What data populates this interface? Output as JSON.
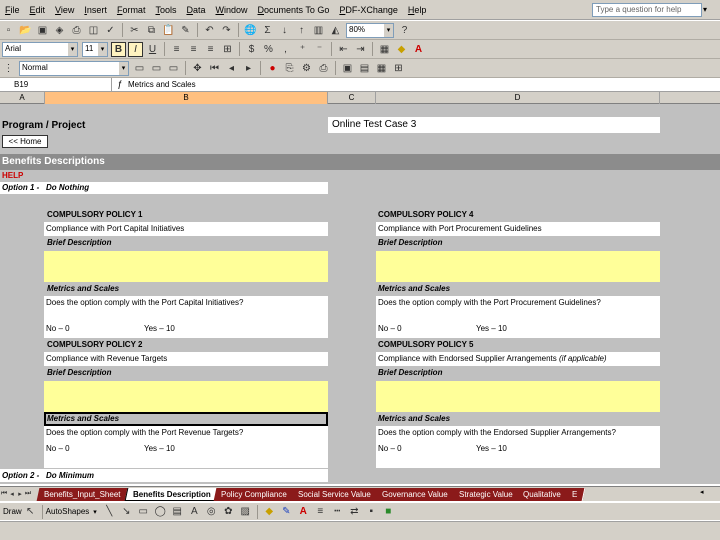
{
  "menu": {
    "items": [
      "File",
      "Edit",
      "View",
      "Insert",
      "Format",
      "Tools",
      "Data",
      "Window",
      "Documents To Go",
      "PDF-XChange",
      "Help"
    ],
    "help_placeholder": "Type a question for help"
  },
  "toolbar1": {
    "zoom": "80%"
  },
  "toolbar2": {
    "font": "Arial",
    "size": "11"
  },
  "toolbar3": {
    "style": "Normal"
  },
  "formula_bar": {
    "cell": "B19",
    "fx": "fx",
    "content": "Metrics and Scales"
  },
  "columns": [
    "A",
    "B",
    "C",
    "D"
  ],
  "sheet": {
    "program_label": "Program / Project",
    "program_value": "Online Test Case 3",
    "home_button": "<< Home",
    "section_header": "Benefits Descriptions",
    "help": "HELP",
    "option1_label": "Option 1 -",
    "option1_value": "Do Nothing",
    "policy1": {
      "title": "COMPULSORY POLICY 1",
      "name": "Compliance with Port Capital Initiatives",
      "brief": "Brief Description",
      "metrics": "Metrics and Scales",
      "question": "Does the option comply with the Port Capital Initiatives?",
      "no": "No – 0",
      "yes": "Yes – 10"
    },
    "policy4": {
      "title": "COMPULSORY POLICY 4",
      "name": "Compliance with Port Procurement Guidelines",
      "brief": "Brief Description",
      "metrics": "Metrics and Scales",
      "question": "Does the option comply with the Port Procurement Guidelines?",
      "no": "No – 0",
      "yes": "Yes – 10"
    },
    "policy2": {
      "title": "COMPULSORY POLICY 2",
      "name": "Compliance with Revenue Targets",
      "brief": "Brief Description",
      "metrics": "Metrics and Scales",
      "question": "Does the option comply with the Port Revenue Targets?",
      "no": "No – 0",
      "yes": "Yes – 10"
    },
    "policy5": {
      "title": "COMPULSORY POLICY 5",
      "name": "Compliance with Endorsed Supplier Arrangements",
      "name_note": "(if applicable)",
      "brief": "Brief Description",
      "metrics": "Metrics and Scales",
      "question": "Does the option comply with the Endorsed Supplier Arrangements?",
      "no": "No – 0",
      "yes": "Yes – 10"
    },
    "option2_label": "Option 2 -",
    "option2_value": "Do Minimum"
  },
  "tabs": [
    "Benefits_Input_Sheet",
    "Benefits Description",
    "Policy Compliance",
    "Social Service Value",
    "Governance Value",
    "Strategic Value",
    "Qualitative",
    "E"
  ],
  "active_tab": "Benefits Description",
  "drawbar": {
    "draw": "Draw",
    "autoshapes": "AutoShapes"
  }
}
